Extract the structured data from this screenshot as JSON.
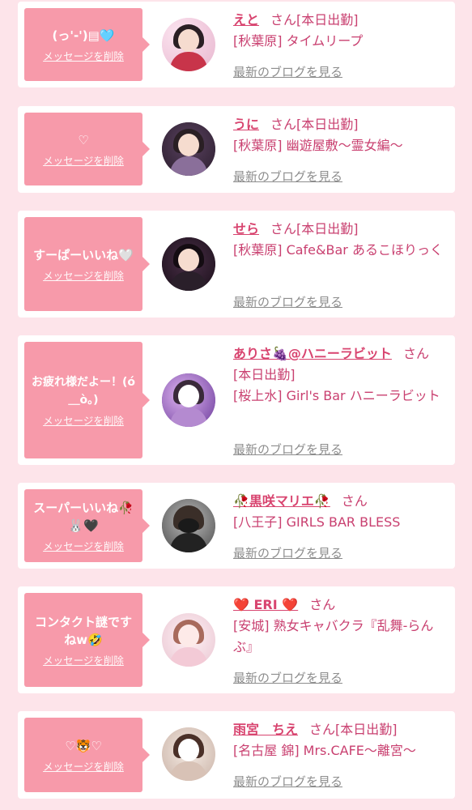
{
  "colors": {
    "page_bg": "#fde4ea",
    "bubble": "#f79aaa",
    "accent": "#d8446f",
    "link_gray": "#8d8d8d"
  },
  "messages": [
    {
      "bubble_text": "(っ'-')▤🩵",
      "delete_label": "メッセージを削除",
      "name": "えと",
      "san": "さん",
      "status": "[本日出勤]",
      "shop": "[秋葉原] タイムリープ",
      "blog_label": "最新のブログを見る",
      "avatar_palette": "pink-purple"
    },
    {
      "bubble_text": "♡",
      "delete_label": "メッセージを削除",
      "name": "うに",
      "san": "さん",
      "status": "[本日出勤]",
      "shop": "[秋葉原] 幽遊屋敷〜霊女編〜",
      "blog_label": "最新のブログを見る",
      "avatar_palette": "purple"
    },
    {
      "bubble_text": "すーぱーいいね🤍",
      "delete_label": "メッセージを削除",
      "name": "せら",
      "san": "さん",
      "status": "[本日出勤]",
      "shop": "[秋葉原] Cafe&Bar あるこほりっく",
      "blog_label": "最新のブログを見る",
      "avatar_palette": "dark"
    },
    {
      "bubble_text": "お疲れ様だよー！(ó＿ò。)",
      "delete_label": "メッセージを削除",
      "name": "ありさ🍇@ハニーラビット",
      "san": "さん",
      "status": "[本日出勤]",
      "shop": "[桜上水] Girl's Bar ハニーラビット",
      "blog_label": "最新のブログを見る",
      "avatar_palette": "violet"
    },
    {
      "bubble_text": "スーパーいいね🥀🐰🖤",
      "delete_label": "メッセージを削除",
      "name": "🥀黒咲マリエ🥀",
      "san": "さん",
      "status": "",
      "shop": "[八王子] GIRLS BAR BLESS",
      "blog_label": "最新のブログを見る",
      "avatar_palette": "gray"
    },
    {
      "bubble_text": "コンタクト謎ですねw🤣",
      "delete_label": "メッセージを削除",
      "name": "❤️ ERI ❤️",
      "san": "さん",
      "status": "",
      "shop": "[安城] 熟女キャバクラ『乱舞-らんぶ』",
      "blog_label": "最新のブログを見る",
      "avatar_palette": "light-pink"
    },
    {
      "bubble_text": "♡🐯♡",
      "delete_label": "メッセージを削除",
      "name": "雨宮　ちえ",
      "san": "さん",
      "status": "[本日出勤]",
      "shop": "[名古屋 錦] Mrs.CAFE〜離宮〜",
      "blog_label": "最新のブログを見る",
      "avatar_palette": "beige"
    }
  ]
}
